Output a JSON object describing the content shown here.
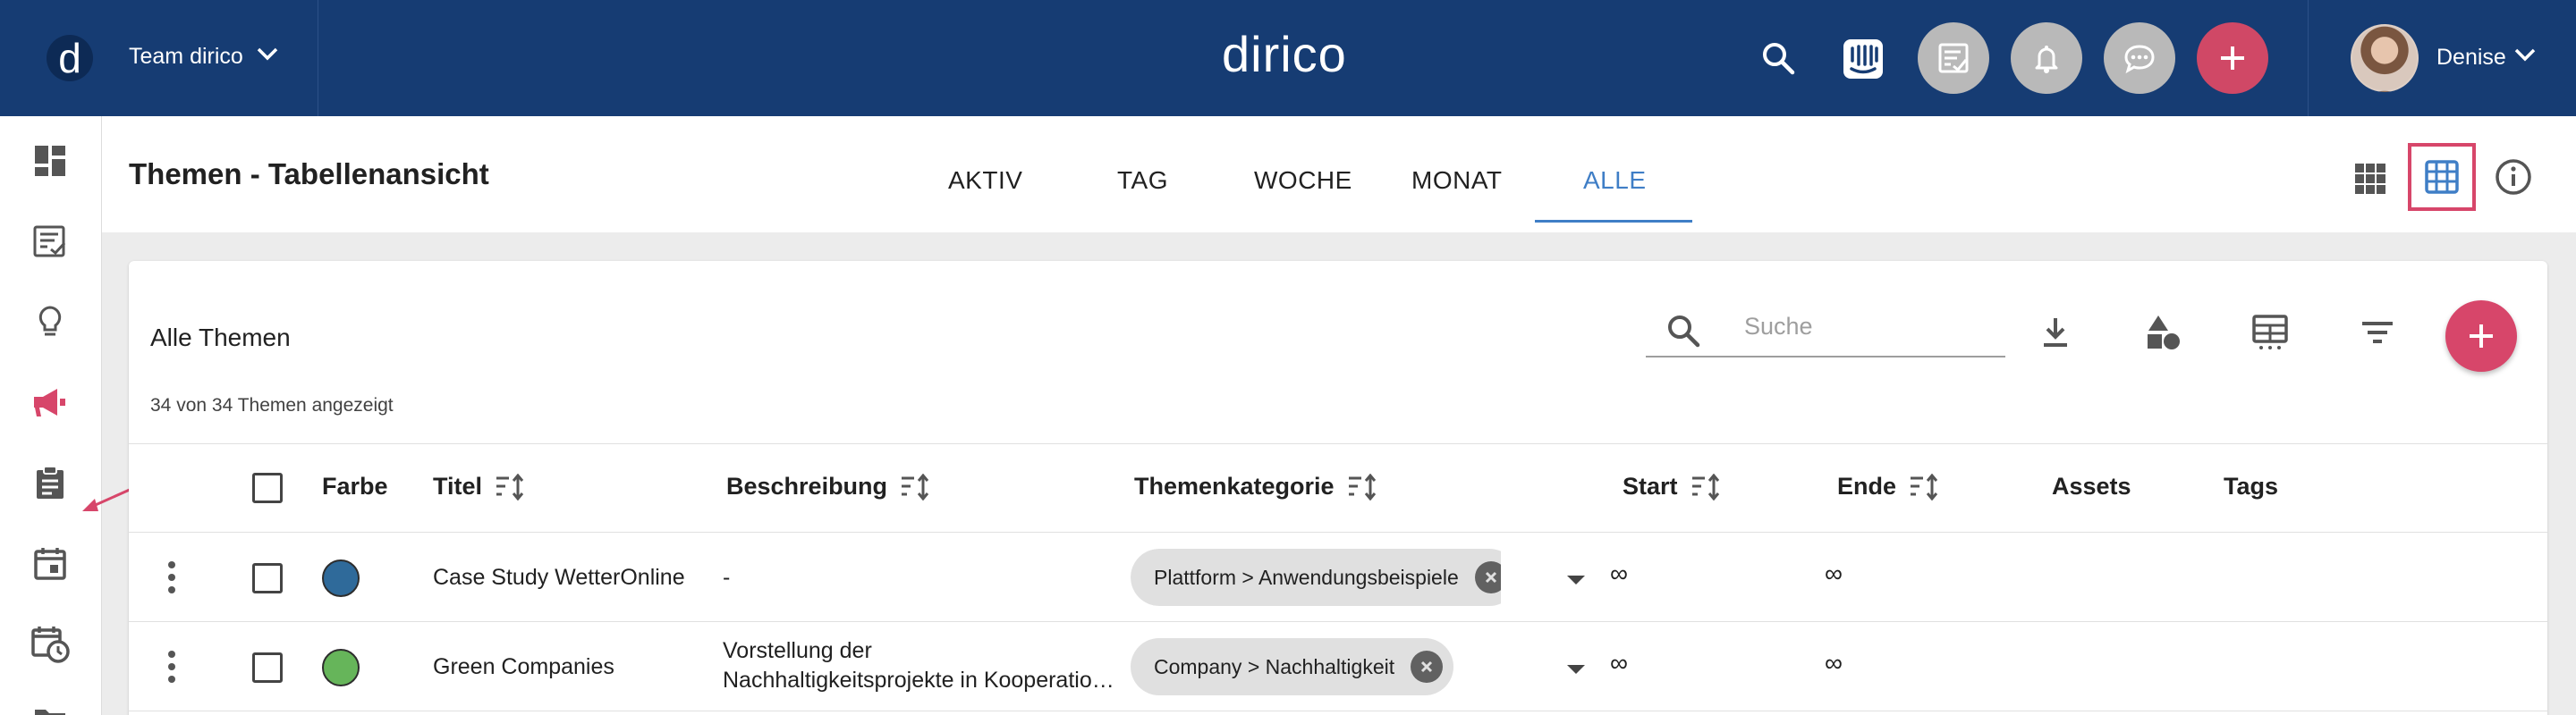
{
  "topbar": {
    "logo_letter": "d",
    "team_name": "Team dirico",
    "brand": "dirico",
    "user_name": "Denise",
    "colors": {
      "bar": "#163c73",
      "accent": "#d04866",
      "round_button": "#b9b9b9"
    }
  },
  "header": {
    "title": "Themen - Tabellenansicht",
    "tabs": [
      "AKTIV",
      "TAG",
      "WOCHE",
      "MONAT",
      "ALLE"
    ],
    "active_tab": "ALLE"
  },
  "card": {
    "title": "Alle Themen",
    "count_text": "34 von 34 Themen angezeigt",
    "search_placeholder": "Suche"
  },
  "table": {
    "columns": [
      "Farbe",
      "Titel",
      "Beschreibung",
      "Themenkategorie",
      "Start",
      "Ende",
      "Assets",
      "Tags"
    ],
    "rows": [
      {
        "color": "#2f6a9a",
        "title": "Case Study WetterOnline",
        "description_line1": "-",
        "description_line2": "",
        "category": "Plattform > Anwendungsbeispiele",
        "start": "∞",
        "end": "∞"
      },
      {
        "color": "#66b55a",
        "title": "Green Companies",
        "description_line1": "Vorstellung der",
        "description_line2": "Nachhaltigkeitsprojekte in Kooperatio…",
        "category": "Company > Nachhaltigkeit",
        "start": "∞",
        "end": "∞"
      }
    ]
  }
}
